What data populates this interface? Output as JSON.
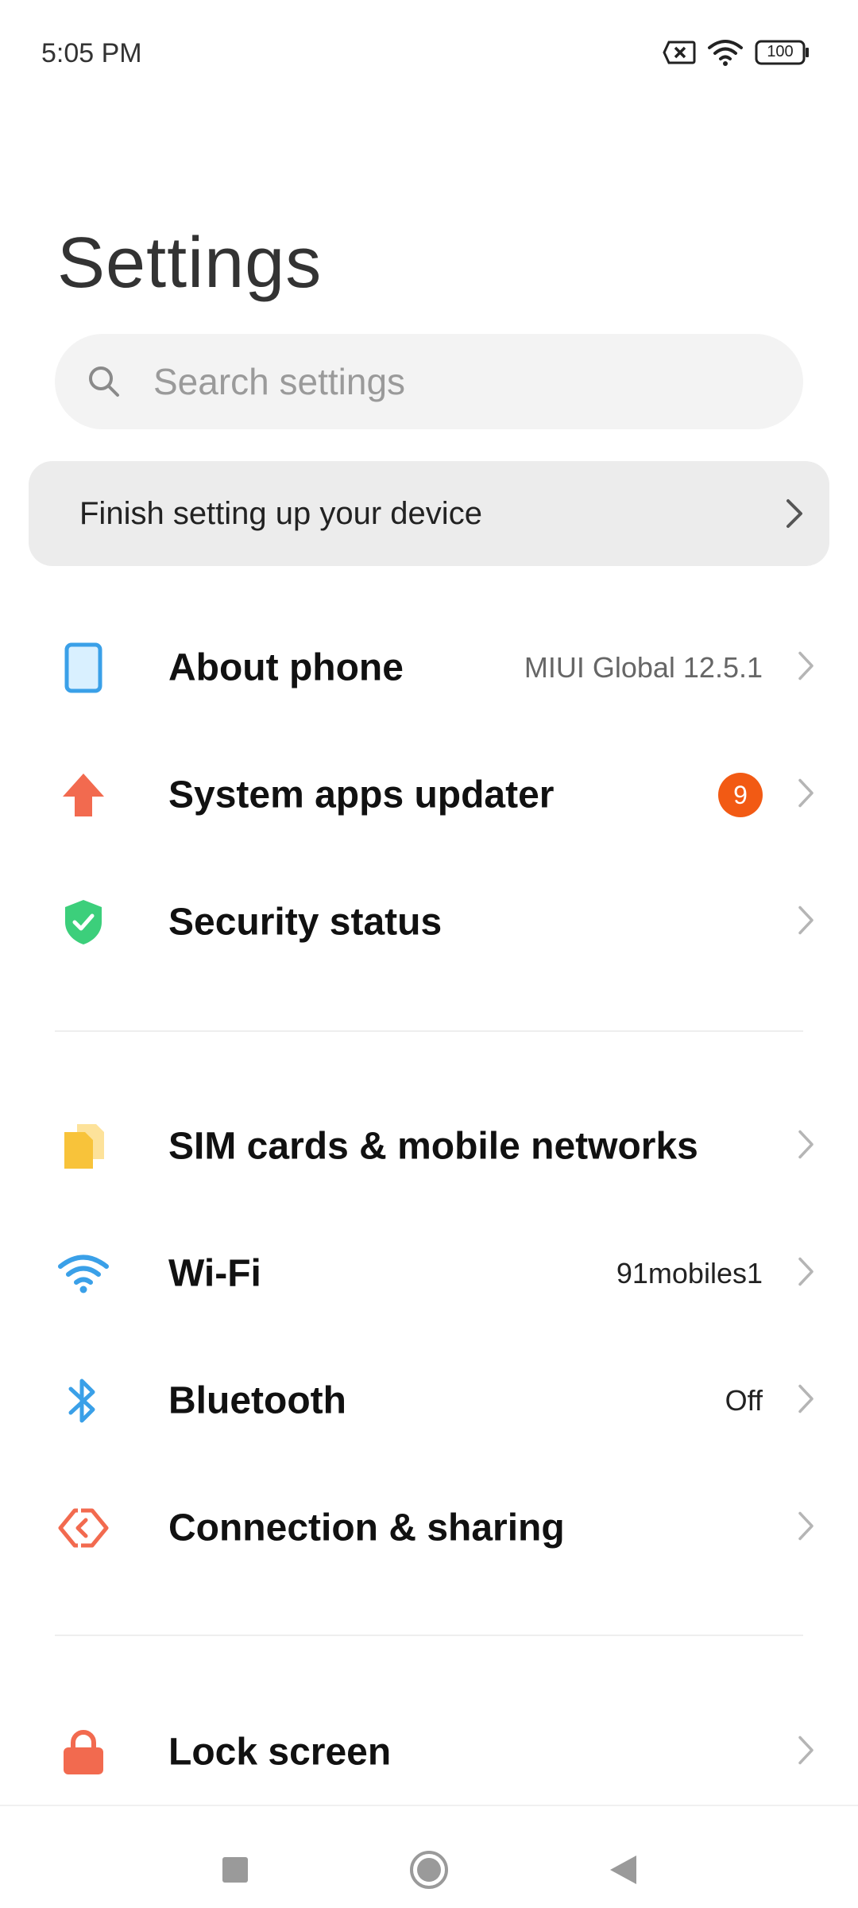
{
  "status_bar": {
    "time": "5:05 PM",
    "battery": "100"
  },
  "header": {
    "title": "Settings"
  },
  "search": {
    "placeholder": "Search settings"
  },
  "setup_prompt": {
    "label": "Finish setting up your device"
  },
  "groups": [
    {
      "items": [
        {
          "label": "About phone",
          "value": "MIUI Global 12.5.1",
          "icon": "phone-icon",
          "color": "#3aa0e8"
        },
        {
          "label": "System apps updater",
          "badge": "9",
          "icon": "arrow-up-icon",
          "color": "#f26a4f"
        },
        {
          "label": "Security status",
          "icon": "shield-check-icon",
          "color": "#3ccf7b"
        }
      ]
    },
    {
      "items": [
        {
          "label": "SIM cards & mobile networks",
          "icon": "sim-card-icon",
          "color": "#f8c33a"
        },
        {
          "label": "Wi-Fi",
          "value": "91mobiles1",
          "icon": "wifi-icon",
          "color": "#3aa0e8"
        },
        {
          "label": "Bluetooth",
          "value": "Off",
          "icon": "bluetooth-icon",
          "color": "#3aa0e8"
        },
        {
          "label": "Connection & sharing",
          "icon": "connection-sharing-icon",
          "color": "#f26a4f"
        }
      ]
    },
    {
      "items": [
        {
          "label": "Lock screen",
          "icon": "lock-icon",
          "color": "#f26a4f"
        }
      ]
    }
  ],
  "colors": {
    "badge": "#f25a14",
    "chevron": "#b5b5b5"
  }
}
